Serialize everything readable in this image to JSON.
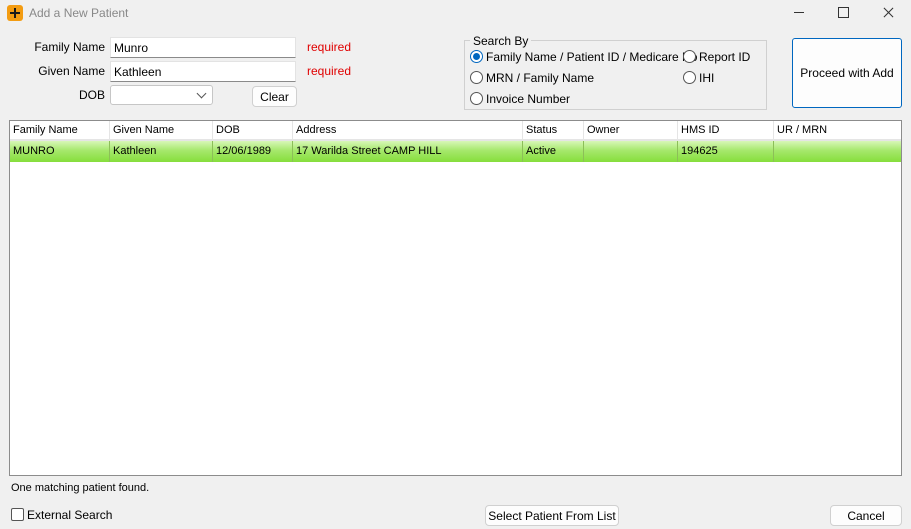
{
  "window": {
    "title": "Add a New Patient"
  },
  "form": {
    "family_name_label": "Family Name",
    "family_name_value": "Munro",
    "given_name_label": "Given Name",
    "given_name_value": "Kathleen",
    "dob_label": "DOB",
    "dob_value": "",
    "required_text": "required",
    "clear_label": "Clear"
  },
  "search_by": {
    "title": "Search By",
    "options": [
      {
        "label": "Family Name / Patient ID / Medicare No",
        "selected": true
      },
      {
        "label": "Report ID",
        "selected": false
      },
      {
        "label": "MRN / Family Name",
        "selected": false
      },
      {
        "label": "IHI",
        "selected": false
      },
      {
        "label": "Invoice Number",
        "selected": false
      }
    ]
  },
  "proceed_label": "Proceed with Add",
  "grid": {
    "columns": [
      "Family Name",
      "Given Name",
      "DOB",
      "Address",
      "Status",
      "Owner",
      "HMS ID",
      "UR / MRN"
    ],
    "rows": [
      [
        "MUNRO",
        "Kathleen",
        "12/06/1989",
        "17 Warilda Street CAMP HILL",
        "Active",
        "",
        "194625",
        ""
      ]
    ]
  },
  "status_text": "One matching patient found.",
  "external_search_label": "External Search",
  "select_label": "Select Patient From List",
  "cancel_label": "Cancel",
  "colors": {
    "selected_row": "#a6e86c",
    "required": "#e00000",
    "accent": "#0067c0"
  }
}
